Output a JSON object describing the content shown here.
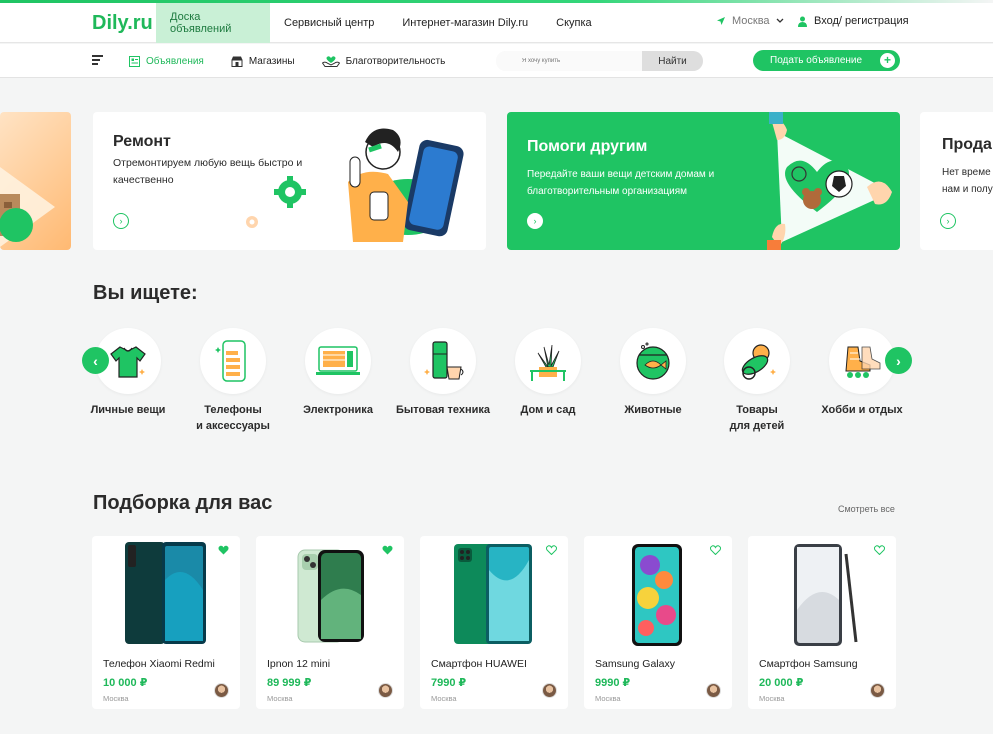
{
  "brand": {
    "logo": "Dily.ru",
    "accent": "#1fc463"
  },
  "header": {
    "nav": [
      {
        "label": "Доска объявлений",
        "active": true
      },
      {
        "label": "Сервисный центр",
        "active": false
      },
      {
        "label": "Интернет-магазин Dily.ru",
        "active": false
      },
      {
        "label": "Скупка",
        "active": false
      }
    ],
    "city": "Москва",
    "login": "Вход/ регистрация"
  },
  "subnav": {
    "items": [
      {
        "label": "Объявления",
        "icon": "ads-icon",
        "active": true
      },
      {
        "label": "Магазины",
        "icon": "store-icon",
        "active": false
      },
      {
        "label": "Благотворительность",
        "icon": "charity-icon",
        "active": false
      }
    ],
    "search_placeholder": "Я хочу купить",
    "search_button": "Найти",
    "post_button": "Подать объявление"
  },
  "banners": {
    "repair": {
      "title": "Ремонт",
      "text": "Отремонтируем любую вещь быстро и качественно"
    },
    "help": {
      "title": "Помоги другим",
      "text": "Передайте ваши вещи детским домам и благотворительным организациям"
    },
    "sell": {
      "title": "Прода",
      "text_line1": "Нет време",
      "text_line2": "нам и полу"
    }
  },
  "categories": {
    "title": "Вы ищете:",
    "items": [
      {
        "line1": "Личные вещи",
        "line2": "",
        "icon": "tshirt-icon"
      },
      {
        "line1": "Телефоны",
        "line2": "и аксессуары",
        "icon": "phone-icon"
      },
      {
        "line1": "Электроника",
        "line2": "",
        "icon": "laptop-icon"
      },
      {
        "line1": "Бытовая техника",
        "line2": "",
        "icon": "fridge-icon"
      },
      {
        "line1": "Дом и сад",
        "line2": "",
        "icon": "plant-icon"
      },
      {
        "line1": "Животные",
        "line2": "",
        "icon": "aquarium-icon"
      },
      {
        "line1": "Товары",
        "line2": "для детей",
        "icon": "pacifier-icon"
      },
      {
        "line1": "Хобби и отдых",
        "line2": "",
        "icon": "skates-icon"
      }
    ]
  },
  "picks": {
    "title": "Подборка для вас",
    "see_all": "Смотреть все",
    "products": [
      {
        "title": "Телефон Xiaomi Redmi",
        "price": "10 000 ₽",
        "city": "Москва",
        "favorite": true
      },
      {
        "title": "Ipnon 12 mini",
        "price": "89 999 ₽",
        "city": "Москва",
        "favorite": true
      },
      {
        "title": "Смартфон HUAWEI",
        "price": "7990 ₽",
        "city": "Москва",
        "favorite": false
      },
      {
        "title": "Samsung Galaxy",
        "price": "9990 ₽",
        "city": "Москва",
        "favorite": false
      },
      {
        "title": "Смартфон Samsung",
        "price": "20 000 ₽",
        "city": "Москва",
        "favorite": false
      }
    ]
  }
}
